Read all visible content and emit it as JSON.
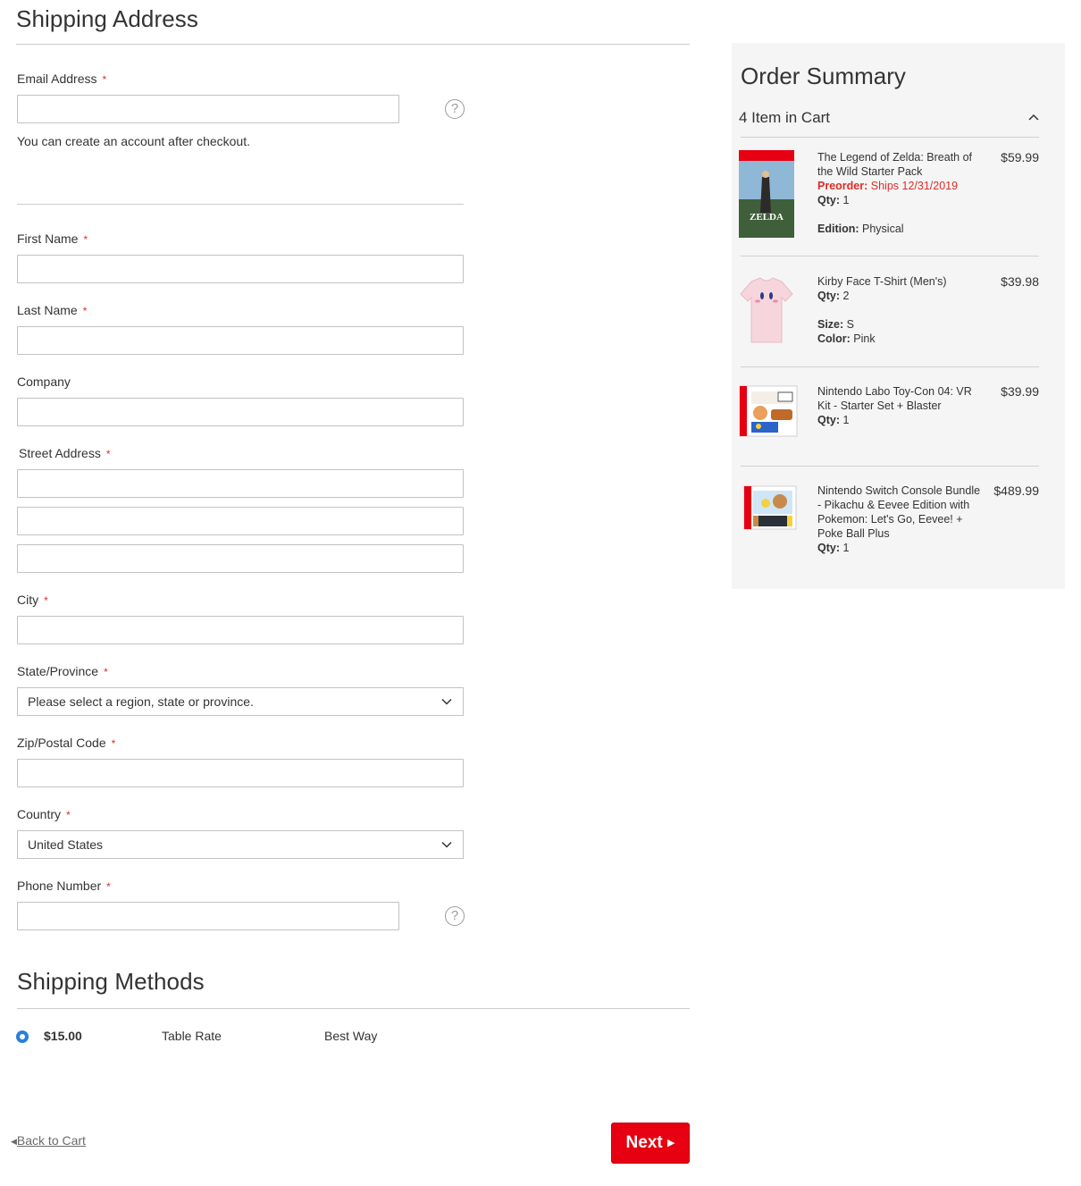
{
  "shipping": {
    "title": "Shipping Address",
    "email": {
      "label": "Email Address",
      "value": "",
      "note": "You can create an account after checkout."
    },
    "first_name": {
      "label": "First Name",
      "value": ""
    },
    "last_name": {
      "label": "Last Name",
      "value": ""
    },
    "company": {
      "label": "Company",
      "value": ""
    },
    "street": {
      "label": "Street Address",
      "line1": "",
      "line2": "",
      "line3": ""
    },
    "city": {
      "label": "City",
      "value": ""
    },
    "state": {
      "label": "State/Province",
      "selected": "Please select a region, state or province."
    },
    "zip": {
      "label": "Zip/Postal Code",
      "value": ""
    },
    "country": {
      "label": "Country",
      "selected": "United States"
    },
    "phone": {
      "label": "Phone Number",
      "value": ""
    },
    "required_mark": "*",
    "help_glyph": "?"
  },
  "methods": {
    "title": "Shipping Methods",
    "rows": [
      {
        "price": "$15.00",
        "method": "Table Rate",
        "carrier": "Best Way",
        "selected": true
      }
    ]
  },
  "summary": {
    "title": "Order Summary",
    "cart_count": "4 Item in Cart",
    "items": [
      {
        "name": "The Legend of Zelda: Breath of the Wild Starter Pack",
        "preorder_label": "Preorder:",
        "preorder_value": "Ships 12/31/2019",
        "qty_label": "Qty:",
        "qty": "1",
        "opt1_label": "Edition:",
        "opt1_value": "Physical",
        "price": "$59.99",
        "thumb_icon": "zelda-game-box"
      },
      {
        "name": "Kirby Face T-Shirt (Men's)",
        "qty_label": "Qty:",
        "qty": "2",
        "opt1_label": "Size:",
        "opt1_value": "S",
        "opt2_label": "Color:",
        "opt2_value": "Pink",
        "price": "$39.98",
        "thumb_icon": "kirby-tshirt"
      },
      {
        "name": "Nintendo Labo Toy-Con 04: VR Kit - Starter Set + Blaster",
        "qty_label": "Qty:",
        "qty": "1",
        "price": "$39.99",
        "thumb_icon": "labo-box"
      },
      {
        "name": "Nintendo Switch Console Bundle - Pikachu & Eevee Edition with Pokemon: Let's Go, Eevee! + Poke Ball Plus",
        "qty_label": "Qty:",
        "qty": "1",
        "price": "$489.99",
        "thumb_icon": "switch-bundle-box"
      }
    ]
  },
  "nav": {
    "back_label": "Back to Cart",
    "next_label": "Next"
  },
  "colors": {
    "accent": "#e60012",
    "required": "#e02b27",
    "radio": "#2c7fd4",
    "summary_bg": "#f5f5f5"
  }
}
